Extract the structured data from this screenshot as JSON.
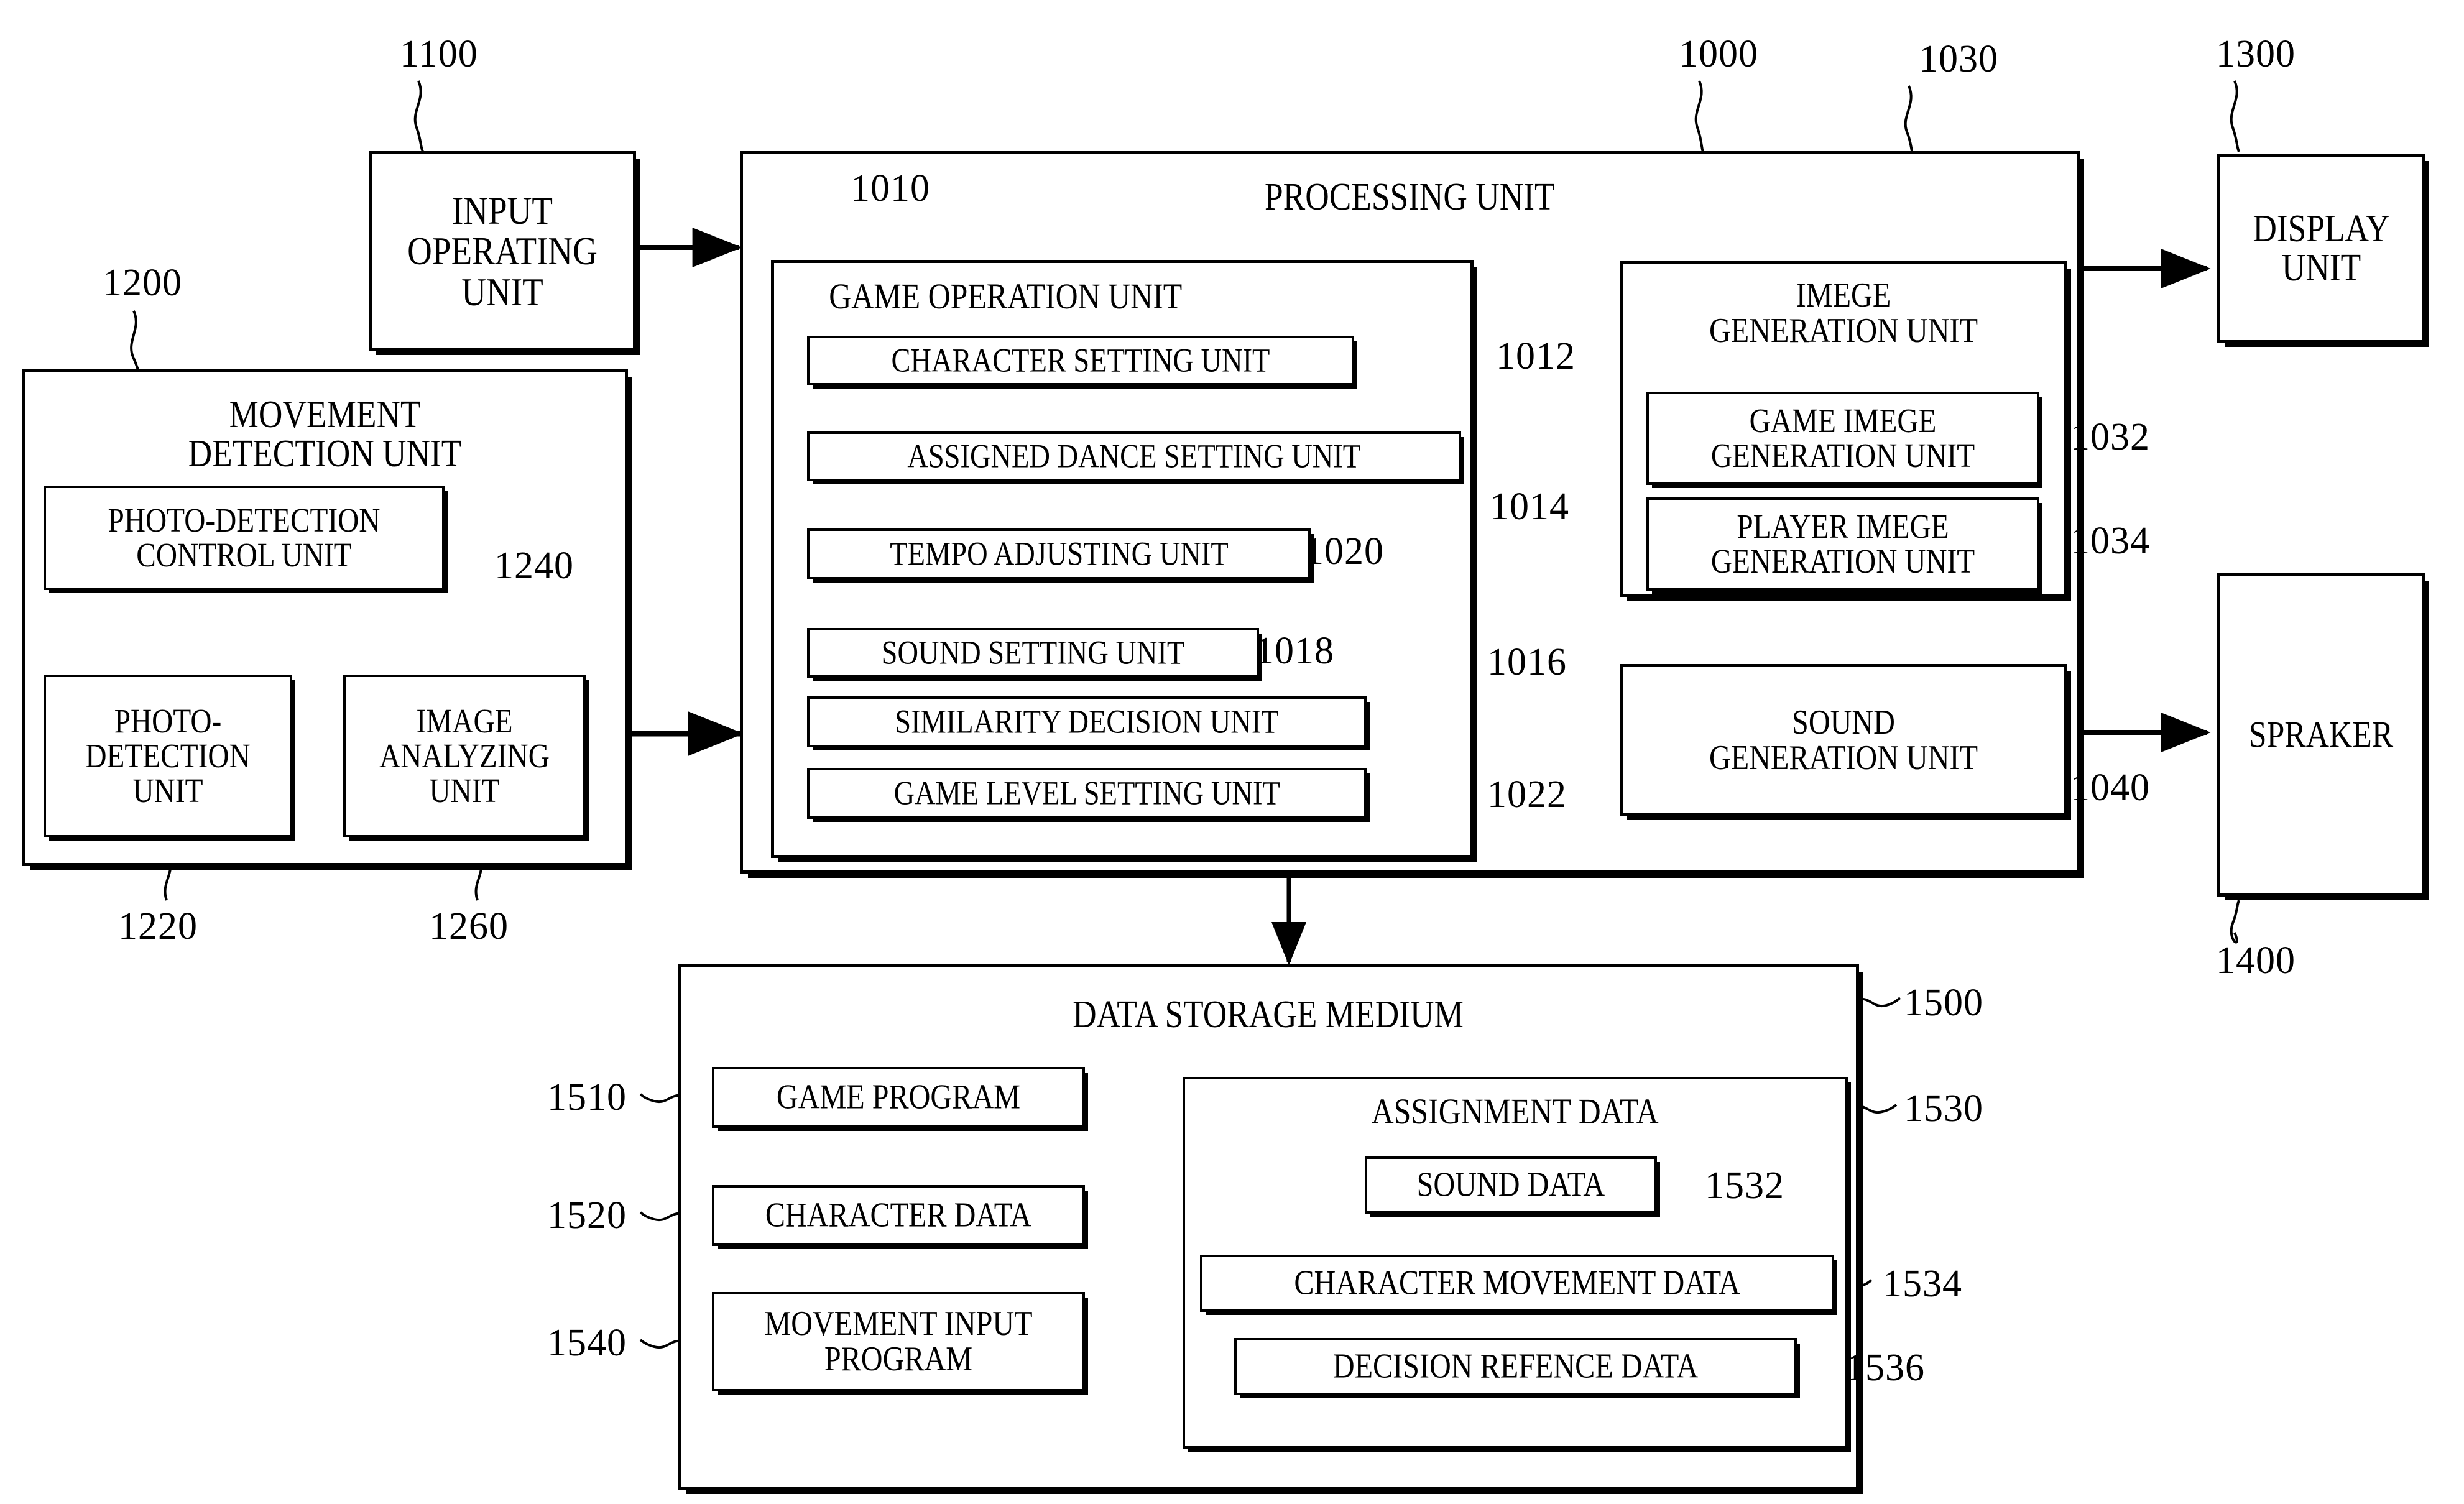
{
  "figure": {
    "type": "patent-block-diagram",
    "background": "#ffffff",
    "line_color": "#000000"
  },
  "blocks": {
    "input_operating_unit": {
      "label_line1": "INPUT",
      "label_line2": "OPERATING",
      "label_line3": "UNIT",
      "ref": "1100"
    },
    "movement_detection_unit": {
      "label_line1": "MOVEMENT",
      "label_line2": "DETECTION UNIT",
      "ref": "1200"
    },
    "photo_detection_control_unit": {
      "label_line1": "PHOTO-DETECTION",
      "label_line2": "CONTROL UNIT",
      "ref": "1240"
    },
    "photo_detection_unit": {
      "label_line1": "PHOTO-",
      "label_line2": "DETECTION",
      "label_line3": "UNIT",
      "ref": "1220"
    },
    "image_analyzing_unit": {
      "label_line1": "IMAGE",
      "label_line2": "ANALYZING",
      "label_line3": "UNIT",
      "ref": "1260"
    },
    "processing_unit": {
      "label": "PROCESSING UNIT",
      "ref": "1000"
    },
    "game_operation_unit": {
      "label": "GAME OPERATION UNIT",
      "ref": "1010"
    },
    "character_setting_unit": {
      "label": "CHARACTER SETTING UNIT",
      "ref": "1012"
    },
    "assigned_dance_setting_unit": {
      "label": "ASSIGNED DANCE SETTING UNIT",
      "ref": "1014"
    },
    "tempo_adjusting_unit": {
      "label": "TEMPO ADJUSTING UNIT",
      "ref": "1020"
    },
    "sound_setting_unit": {
      "label": "SOUND SETTING UNIT",
      "ref": "1018"
    },
    "similarity_decision_unit": {
      "label": "SIMILARITY DECISION UNIT",
      "ref": "1016"
    },
    "game_level_setting_unit": {
      "label": "GAME LEVEL SETTING UNIT",
      "ref": "1022"
    },
    "image_generation_unit": {
      "label_line1": "IMEGE",
      "label_line2": "GENERATION UNIT",
      "ref": "1030"
    },
    "game_image_generation_unit": {
      "label_line1": "GAME IMEGE",
      "label_line2": "GENERATION UNIT",
      "ref": "1032"
    },
    "player_image_generation_unit": {
      "label_line1": "PLAYER IMEGE",
      "label_line2": "GENERATION UNIT",
      "ref": "1034"
    },
    "sound_generation_unit": {
      "label_line1": "SOUND",
      "label_line2": "GENERATION UNIT",
      "ref": "1040"
    },
    "display_unit": {
      "label_line1": "DISPLAY",
      "label_line2": "UNIT",
      "ref": "1300"
    },
    "speaker": {
      "label": "SPRAKER",
      "ref": "1400"
    },
    "data_storage_medium": {
      "label": "DATA STORAGE MEDIUM",
      "ref": "1500"
    },
    "game_program": {
      "label": "GAME PROGRAM",
      "ref": "1510"
    },
    "character_data": {
      "label": "CHARACTER DATA",
      "ref": "1520"
    },
    "movement_input_program": {
      "label_line1": "MOVEMENT INPUT",
      "label_line2": "PROGRAM",
      "ref": "1540"
    },
    "assignment_data": {
      "label": "ASSIGNMENT DATA",
      "ref": "1530"
    },
    "sound_data": {
      "label": "SOUND DATA",
      "ref": "1532"
    },
    "character_movement_data": {
      "label": "CHARACTER MOVEMENT DATA",
      "ref": "1534"
    },
    "decision_reference_data": {
      "label": "DECISION REFENCE DATA",
      "ref": "1536"
    }
  }
}
